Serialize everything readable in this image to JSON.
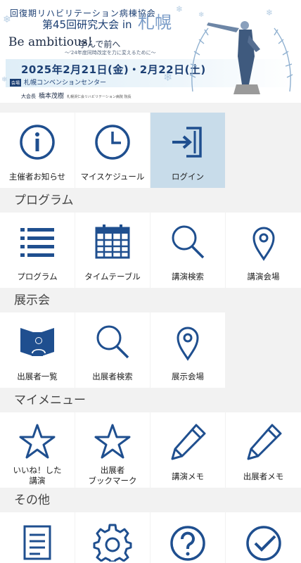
{
  "banner": {
    "org": "回復期リハビリテーション病棟協会",
    "event": "第45回研究大会 in",
    "city": "札幌",
    "slogan": "Be ambitious!",
    "slogan_sub": "学んで前へ",
    "tagline": "〜'24年度同時改定を力に変えるために〜",
    "date": "2025年2月21日(金)・2月22日(土)",
    "venue_tag": "会場",
    "venue": "札幌コンベンションセンター",
    "president_title": "大会長",
    "president_name": "橋本茂樹",
    "president_affiliation": "札幌渓仁会リハビリテーション病院 院長"
  },
  "top_tiles": [
    {
      "label": "主催者お知らせ",
      "icon": "info-icon",
      "active": false
    },
    {
      "label": "マイスケジュール",
      "icon": "clock-icon",
      "active": false
    },
    {
      "label": "ログイン",
      "icon": "login-icon",
      "active": true
    }
  ],
  "sections": [
    {
      "title": "プログラム",
      "tiles": [
        {
          "label": "プログラム",
          "icon": "list-icon"
        },
        {
          "label": "タイムテーブル",
          "icon": "calendar-icon"
        },
        {
          "label": "講演検索",
          "icon": "search-icon"
        },
        {
          "label": "講演会場",
          "icon": "location-pin-icon"
        }
      ]
    },
    {
      "title": "展示会",
      "tiles": [
        {
          "label": "出展者一覧",
          "icon": "exhibitor-icon"
        },
        {
          "label": "出展者検索",
          "icon": "search-icon"
        },
        {
          "label": "展示会場",
          "icon": "location-pin-icon"
        }
      ]
    },
    {
      "title": "マイメニュー",
      "tiles": [
        {
          "label": "いいね！した\n講演",
          "icon": "star-icon"
        },
        {
          "label": "出展者\nブックマーク",
          "icon": "star-icon"
        },
        {
          "label": "講演メモ",
          "icon": "pencil-icon"
        },
        {
          "label": "出展者メモ",
          "icon": "pencil-icon"
        }
      ]
    },
    {
      "title": "その他",
      "tiles": [
        {
          "label": "",
          "icon": "document-icon"
        },
        {
          "label": "",
          "icon": "settings-gear-icon"
        },
        {
          "label": "",
          "icon": "help-icon"
        },
        {
          "label": "",
          "icon": "checkmark-icon"
        }
      ]
    }
  ],
  "colors": {
    "icon": "#1f4f8f",
    "active_tile": "#c8dcea",
    "background": "#f2f2f2"
  }
}
